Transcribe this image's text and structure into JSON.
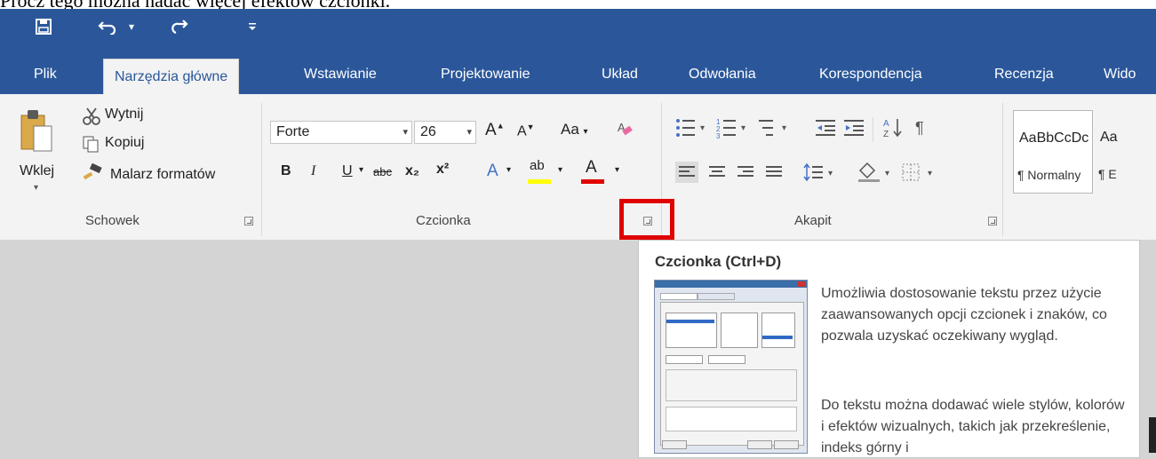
{
  "document_text": "Prócz tego można nadać więcej efektów czcionki.",
  "quick_access": [
    {
      "name": "save-icon",
      "glyph": "🖫"
    },
    {
      "name": "undo-icon",
      "glyph": "↶"
    },
    {
      "name": "undo-dropdown-icon",
      "glyph": "▾"
    },
    {
      "name": "redo-icon",
      "glyph": "↷"
    },
    {
      "name": "customize-qat-icon",
      "glyph": "▾"
    }
  ],
  "tabs": [
    "Plik",
    "Narzędzia główne",
    "Wstawianie",
    "Projektowanie",
    "Układ",
    "Odwołania",
    "Korespondencja",
    "Recenzja",
    "Wido"
  ],
  "clipboard": {
    "paste_label": "Wklej",
    "cut_label": "Wytnij",
    "copy_label": "Kopiuj",
    "painter_label": "Malarz formatów",
    "group_label": "Schowek"
  },
  "font": {
    "font_name": "Forte",
    "font_size": "26",
    "change_case": "Aa",
    "group_label": "Czcionka",
    "bold": "B",
    "italic": "I",
    "underline": "U",
    "strikethrough": "abc",
    "subscript": "x₂",
    "superscript": "x²",
    "text_effects": "A",
    "highlight": "ab",
    "font_color": "A",
    "grow": "A",
    "shrink": "A"
  },
  "paragraph": {
    "group_label": "Akapit"
  },
  "styles": [
    {
      "preview": "AaBbCcDc",
      "name": "¶ Normalny"
    },
    {
      "preview": "Aa",
      "name": "¶ E"
    }
  ],
  "tooltip": {
    "title": "Czcionka (Ctrl+D)",
    "p1": "Umożliwia dostosowanie tekstu przez użycie zaawansowanych opcji czcionek i znaków, co pozwala uzyskać oczekiwany wygląd.",
    "p2": "Do tekstu można dodawać wiele stylów, kolorów i efektów wizualnych, takich jak przekreślenie, indeks górny i"
  },
  "colors": {
    "ribbon_blue": "#2b579a",
    "ribbon_bg": "#f3f3f3",
    "highlight_red": "#e00000",
    "highlighter_yellow": "#ffff00",
    "font_color_red": "#e00000"
  }
}
